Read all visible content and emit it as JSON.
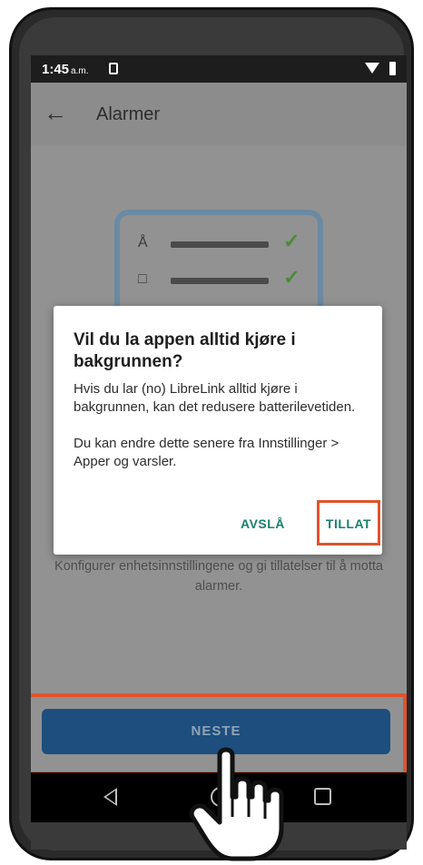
{
  "status_bar": {
    "time": "1:45",
    "ampm": "a.m."
  },
  "header": {
    "title": "Alarmer"
  },
  "dialog": {
    "title": "Vil du la appen alltid kjøre i bakgrunnen?",
    "body": "Hvis du lar (no) LibreLink alltid kjøre i bakgrunnen, kan det redusere batterilevetiden.\n\nDu kan endre dette senere fra Innstillinger > Apper og varsler.",
    "deny_label": "AVSLÅ",
    "allow_label": "TILLAT"
  },
  "description": "Konfigurer enhetsinnstillingene og gi tillatelser til å motta alarmer.",
  "next_button": {
    "label": "NESTE"
  },
  "colors": {
    "highlight": "#e0542b",
    "primary": "#1d4e7e",
    "dialog_button": "#17806f"
  }
}
